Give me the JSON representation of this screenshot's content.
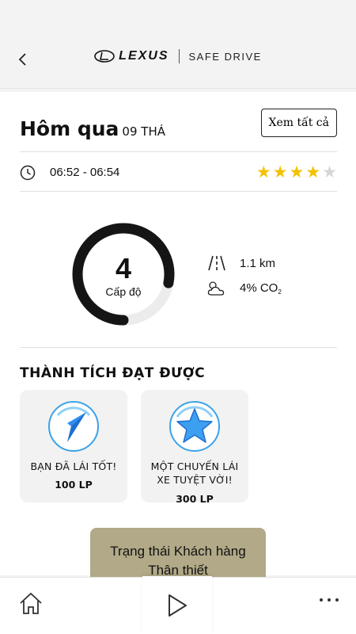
{
  "header": {
    "brand": "LEXUS",
    "subtitle": "SAFE DRIVE"
  },
  "trip": {
    "title": "Hôm qua",
    "date": "09 THÁ",
    "see_all_label": "Xem tất cả",
    "time_range": "06:52 - 06:54",
    "rating": 4,
    "rating_max": 5
  },
  "score": {
    "level_value": "4",
    "level_label": "Cấp độ",
    "gauge_fill": 0.78
  },
  "metrics": {
    "distance": "1.1 km",
    "co2_prefix": "4% CO",
    "co2_subscript": "2"
  },
  "achievements": {
    "title": "THÀNH TÍCH ĐẠT ĐƯỢC",
    "items": [
      {
        "label": "BẠN ĐÃ LÁI TỐT!",
        "points": "100 LP",
        "icon": "navigation-arrow-icon"
      },
      {
        "label": "MỘT CHUYẾN LÁI XE TUYỆT VỜI!",
        "points": "300 LP",
        "icon": "star-icon"
      }
    ]
  },
  "loyalty": {
    "label_line1": "Trạng thái Khách hàng",
    "label_line2": "Thân thiết"
  },
  "colors": {
    "star_on": "#f2c200",
    "star_off": "#d6d6d6",
    "badge_blue": "#2f8ff0",
    "loyalty_bg": "#b1a987"
  }
}
